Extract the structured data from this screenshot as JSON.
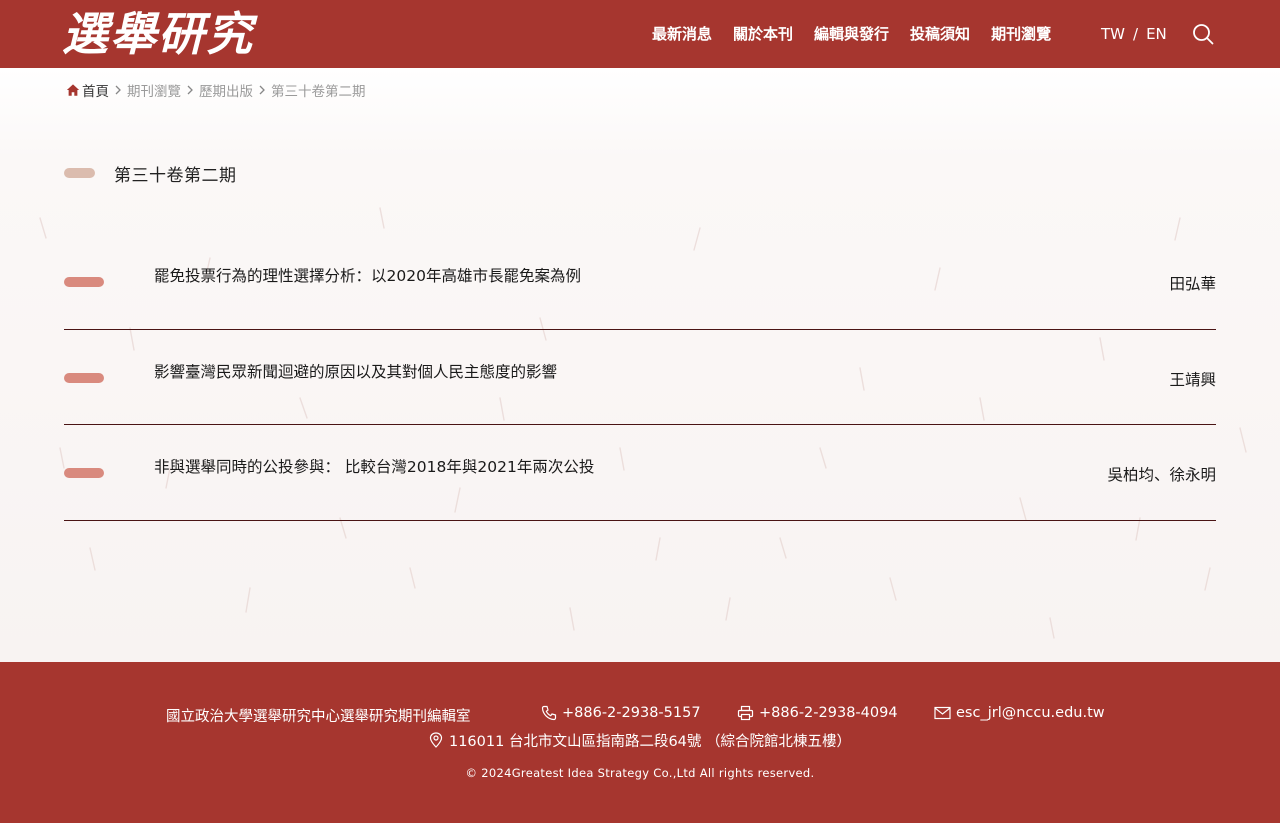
{
  "header": {
    "logo": "選舉研究",
    "nav": [
      "最新消息",
      "關於本刊",
      "編輯與發行",
      "投稿須知",
      "期刊瀏覽"
    ],
    "lang": {
      "tw": "TW",
      "sep": "/",
      "en": "EN"
    },
    "search_icon": "search-icon"
  },
  "breadcrumb": {
    "home": "首頁",
    "items": [
      "期刊瀏覽",
      "歷期出版",
      "第三十卷第二期"
    ]
  },
  "issue": {
    "title": "第三十卷第二期"
  },
  "articles": [
    {
      "title": "罷免投票行為的理性選擇分析：以2020年高雄市長罷免案為例",
      "author": "田弘華"
    },
    {
      "title": "影響臺灣民眾新聞迴避的原因以及其對個人民主態度的影響",
      "author": "王靖興"
    },
    {
      "title": "非與選舉同時的公投參與： 比較台灣2018年與2021年兩次公投",
      "author": "吳柏均、徐永明"
    }
  ],
  "footer": {
    "org": "國立政治大學選舉研究中心選舉研究期刊編輯室",
    "phone": "+886-2-2938-5157",
    "fax": "+886-2-2938-4094",
    "email": "esc_jrl@nccu.edu.tw",
    "address": "116011 台北市文山區指南路二段64號 （綜合院館北棟五樓）",
    "copyright": "© 2024Greatest Idea Strategy Co.,Ltd All rights reserved."
  },
  "colors": {
    "brand": "#a6362f",
    "issue_bar": "#dbbcae",
    "article_bar": "#d98a7e",
    "divider": "#4a1414"
  }
}
